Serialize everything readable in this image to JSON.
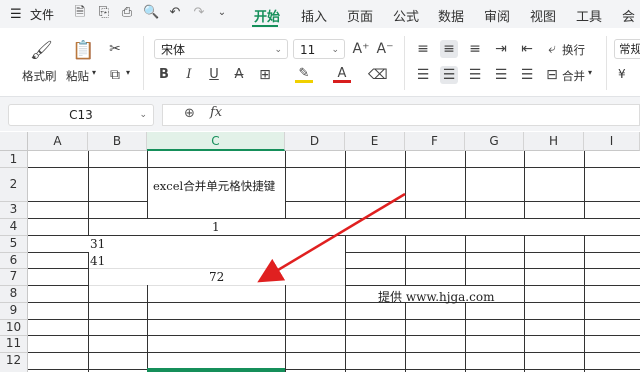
{
  "menu": {
    "hamburger": "☰",
    "file": "文件",
    "tabs": [
      "开始",
      "插入",
      "页面",
      "公式",
      "数据",
      "审阅",
      "视图",
      "工具",
      "会"
    ]
  },
  "ribbon": {
    "format_painter": "格式刷",
    "paste": "粘贴",
    "font_name": "宋体",
    "font_size": "11",
    "wrap_text": "换行",
    "merge": "合并",
    "number_format": "常规",
    "currency": "¥"
  },
  "formula_bar": {
    "cell_ref": "C13",
    "fx": "fx",
    "content": ""
  },
  "sheet": {
    "columns": [
      "A",
      "B",
      "C",
      "D",
      "E",
      "F",
      "G",
      "H",
      "I"
    ],
    "selected_column": "C",
    "rows": [
      "1",
      "2",
      "3",
      "4",
      "5",
      "6",
      "7",
      "8",
      "9",
      "10",
      "11",
      "12"
    ],
    "cells": {
      "c2_merged": "excel合并单元格快捷键",
      "row4_merged": "1",
      "b5": "31",
      "b6": "41",
      "row7_merged": "72",
      "e8_note": "提供 www.hjga.com"
    }
  },
  "colors": {
    "accent": "#158f5a",
    "arrow": "#e02020"
  }
}
